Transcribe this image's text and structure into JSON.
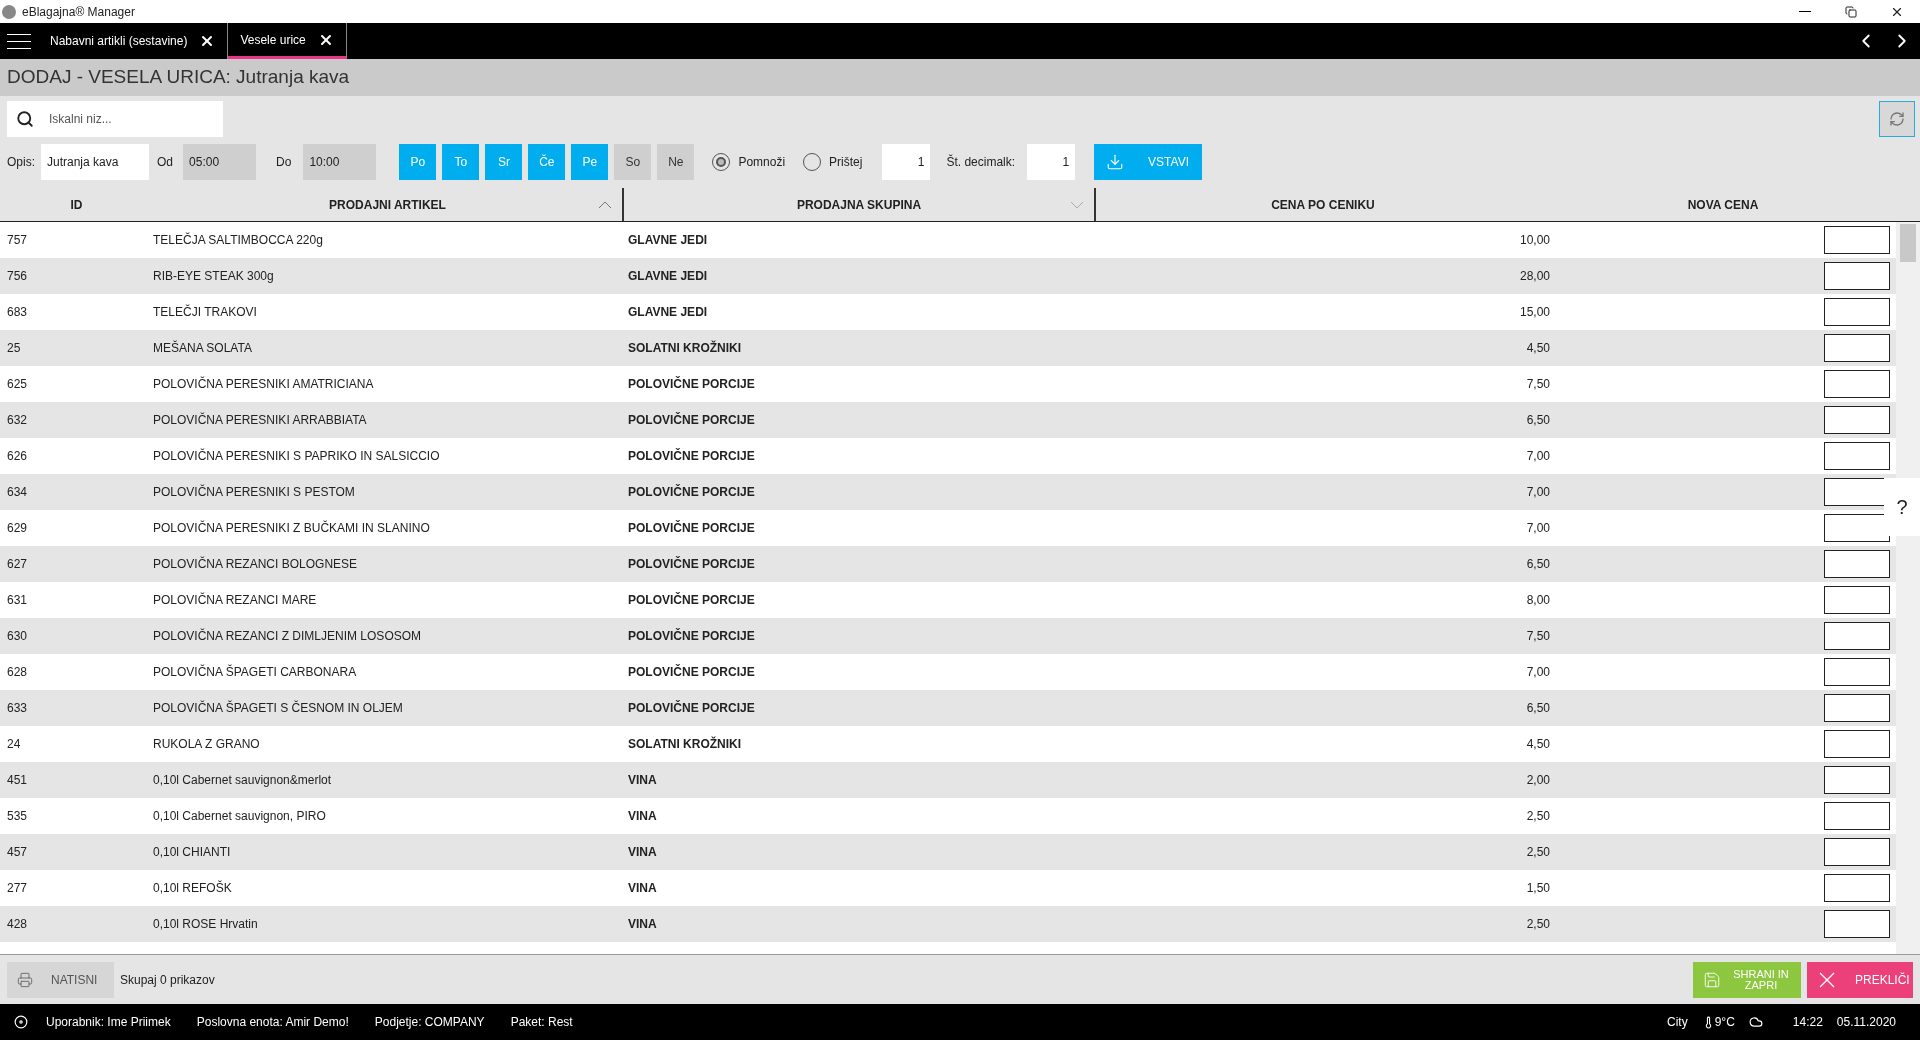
{
  "window": {
    "title": "eBlagajna® Manager"
  },
  "tabs": [
    {
      "label": "Nabavni artikli (sestavine)",
      "selected": false
    },
    {
      "label": "Vesele urice",
      "selected": true
    }
  ],
  "heading": "DODAJ - VESELA URICA: Jutranja kava",
  "search": {
    "placeholder": "Iskalni niz..."
  },
  "form": {
    "opis_label": "Opis:",
    "opis_value": "Jutranja kava",
    "od_label": "Od",
    "od_value": "05:00",
    "do_label": "Do",
    "do_value": "10:00",
    "days": [
      {
        "label": "Po",
        "selected": true
      },
      {
        "label": "To",
        "selected": true
      },
      {
        "label": "Sr",
        "selected": true
      },
      {
        "label": "Če",
        "selected": true
      },
      {
        "label": "Pe",
        "selected": true
      },
      {
        "label": "So",
        "selected": false
      },
      {
        "label": "Ne",
        "selected": false
      }
    ],
    "modes": [
      {
        "label": "Pomnoži",
        "selected": true
      },
      {
        "label": "Prištej",
        "selected": false
      }
    ],
    "factor": "1",
    "decimals_label": "Št. decimalk:",
    "decimals": "1",
    "insert_button": "VSTAVI"
  },
  "table": {
    "columns": [
      "ID",
      "PRODAJNI ARTIKEL",
      "PRODAJNA SKUPINA",
      "CENA PO CENIKU",
      "NOVA CENA"
    ],
    "rows": [
      [
        "757",
        "TELEČJA SALTIMBOCCA 220g",
        "GLAVNE JEDI",
        "10,00"
      ],
      [
        "756",
        "RIB-EYE STEAK 300g",
        "GLAVNE JEDI",
        "28,00"
      ],
      [
        "683",
        "TELEČJI TRAKOVI",
        "GLAVNE JEDI",
        "15,00"
      ],
      [
        "25",
        "MEŠANA SOLATA",
        "SOLATNI KROŽNIKI",
        "4,50"
      ],
      [
        "625",
        "POLOVIČNA PERESNIKI AMATRICIANA",
        "POLOVIČNE PORCIJE",
        "7,50"
      ],
      [
        "632",
        "POLOVIČNA PERESNIKI ARRABBIATA",
        "POLOVIČNE PORCIJE",
        "6,50"
      ],
      [
        "626",
        "POLOVIČNA PERESNIKI S PAPRIKO IN SALSICCIO",
        "POLOVIČNE PORCIJE",
        "7,00"
      ],
      [
        "634",
        "POLOVIČNA PERESNIKI S PESTOM",
        "POLOVIČNE PORCIJE",
        "7,00"
      ],
      [
        "629",
        "POLOVIČNA PERESNIKI Z BUČKAMI IN SLANINO",
        "POLOVIČNE PORCIJE",
        "7,00"
      ],
      [
        "627",
        "POLOVIČNA REZANCI BOLOGNESE",
        "POLOVIČNE PORCIJE",
        "6,50"
      ],
      [
        "631",
        "POLOVIČNA REZANCI MARE",
        "POLOVIČNE PORCIJE",
        "8,00"
      ],
      [
        "630",
        "POLOVIČNA REZANCI Z DIMLJENIM LOSOSOM",
        "POLOVIČNE PORCIJE",
        "7,50"
      ],
      [
        "628",
        "POLOVIČNA ŠPAGETI CARBONARA",
        "POLOVIČNE PORCIJE",
        "7,00"
      ],
      [
        "633",
        "POLOVIČNA ŠPAGETI S ČESNOM IN OLJEM",
        "POLOVIČNE PORCIJE",
        "6,50"
      ],
      [
        "24",
        "RUKOLA Z GRANO",
        "SOLATNI KROŽNIKI",
        "4,50"
      ],
      [
        "451",
        "0,10l Cabernet sauvignon&merlot",
        "VINA",
        "2,00"
      ],
      [
        "535",
        "0,10l Cabernet sauvignon, PIRO",
        "VINA",
        "2,50"
      ],
      [
        "457",
        "0,10l CHIANTI",
        "VINA",
        "2,50"
      ],
      [
        "277",
        "0,10l REFOŠK",
        "VINA",
        "1,50"
      ],
      [
        "428",
        "0,10l ROSE Hrvatin",
        "VINA",
        "2,50"
      ]
    ]
  },
  "help": "?",
  "footer": {
    "print_button": "NATISNI",
    "total": "Skupaj 0 prikazov",
    "save_button": "SHRANI IN ZAPRI",
    "cancel_button": "PREKLIČI"
  },
  "status_bar": {
    "items": [
      "Uporabnik: Ime Priimek",
      "Poslovna enota: Amir Demo!",
      "Podjetje: COMPANY",
      "Paket: Rest"
    ],
    "city": "City",
    "temperature": "9°C",
    "time": "14:22",
    "date": "05.11.2020"
  }
}
